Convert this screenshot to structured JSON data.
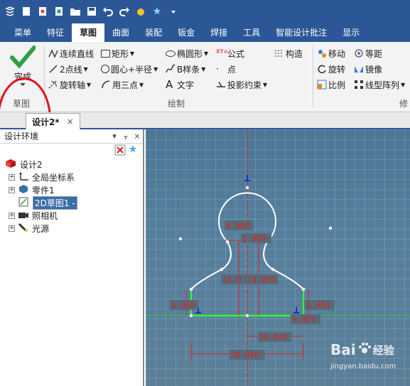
{
  "quick_access": {
    "icons": [
      "app-logo-icon",
      "new-icon",
      "open-icon",
      "save-as-icon",
      "folder-icon",
      "save-icon",
      "undo-icon",
      "redo-icon",
      "settings-icon",
      "feature-icon",
      "dropdown-icon"
    ]
  },
  "tabs": [
    "菜单",
    "特征",
    "草图",
    "曲面",
    "装配",
    "钣金",
    "焊接",
    "工具",
    "智能设计批注",
    "显示"
  ],
  "active_tab": "草图",
  "ribbon": {
    "done": {
      "label": "完成",
      "group": "草图"
    },
    "draw": {
      "group": "绘制",
      "items": [
        "连续直线",
        "2点线",
        "旋转轴",
        "矩形",
        "圆心+半径",
        "用三点",
        "椭圆形",
        "B样条",
        "文字",
        "公式",
        "点",
        "投影约束",
        "构造"
      ]
    },
    "modify": {
      "group": "修",
      "items": [
        "移动",
        "旋转",
        "比例",
        "等距",
        "镜像",
        "线型阵列"
      ]
    }
  },
  "document": {
    "tab": "设计2*",
    "close": "×"
  },
  "panel": {
    "title": "设计环境",
    "pin": "▾",
    "float": "ᚁ",
    "close": "×",
    "tree": [
      {
        "label": "设计2",
        "expander": ""
      },
      {
        "label": "全局坐标系",
        "expander": "+"
      },
      {
        "label": "零件1",
        "expander": "+"
      },
      {
        "label": "2D草图1 -",
        "expander": ""
      },
      {
        "label": "照相机",
        "expander": "+"
      },
      {
        "label": "光源",
        "expander": "+"
      }
    ]
  },
  "dimensions": {
    "d1": "6.000",
    "d2": "3.000",
    "d3": "14.0",
    "d4": "14.000",
    "d5": "5.000",
    "d6": "5.000",
    "d7": "0.000",
    "d8": "10.000",
    "d9": "20.000"
  },
  "watermark": {
    "brand": "Bai",
    "suffix": "经验",
    "url": "jingyan.baidu.com"
  }
}
